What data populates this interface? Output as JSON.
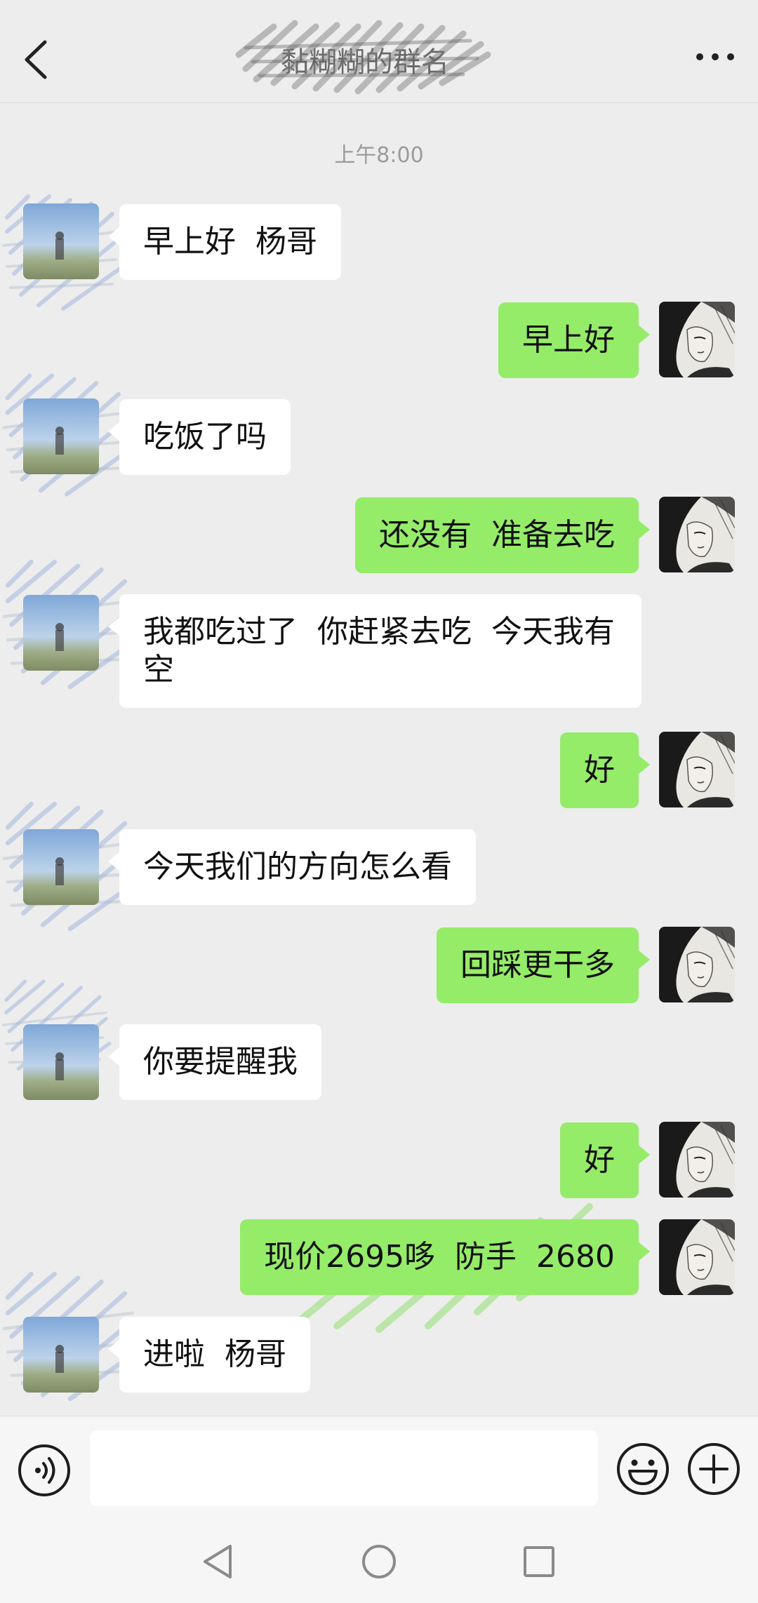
{
  "header": {
    "title": "黏糊糊的群名",
    "back_icon": "chevron-left-icon",
    "more_icon": "more-dots-icon"
  },
  "timestamp": "上午8:00",
  "messages": [
    {
      "side": "left",
      "text": "早上好  杨哥"
    },
    {
      "side": "right",
      "text": "早上好"
    },
    {
      "side": "left",
      "text": "吃饭了吗"
    },
    {
      "side": "right",
      "text": "还没有  准备去吃"
    },
    {
      "side": "left",
      "text": "我都吃过了  你赶紧去吃  今天我有空"
    },
    {
      "side": "right",
      "text": "好"
    },
    {
      "side": "left",
      "text": "今天我们的方向怎么看"
    },
    {
      "side": "right",
      "text": "回踩更干多"
    },
    {
      "side": "left",
      "text": "你要提醒我"
    },
    {
      "side": "right",
      "text": "好"
    },
    {
      "side": "right",
      "text": "现价2695哆  防手  2680"
    },
    {
      "side": "left",
      "text": "进啦  杨哥"
    }
  ],
  "input_bar": {
    "voice_icon": "voice-icon",
    "input_value": "",
    "emoji_icon": "emoji-icon",
    "plus_icon": "plus-icon"
  },
  "navbar": {
    "back_icon": "nav-back-icon",
    "home_icon": "nav-home-icon",
    "recent_icon": "nav-recent-icon"
  },
  "colors": {
    "background": "#ededed",
    "bubble_self": "#95ec69",
    "bubble_other": "#ffffff"
  }
}
